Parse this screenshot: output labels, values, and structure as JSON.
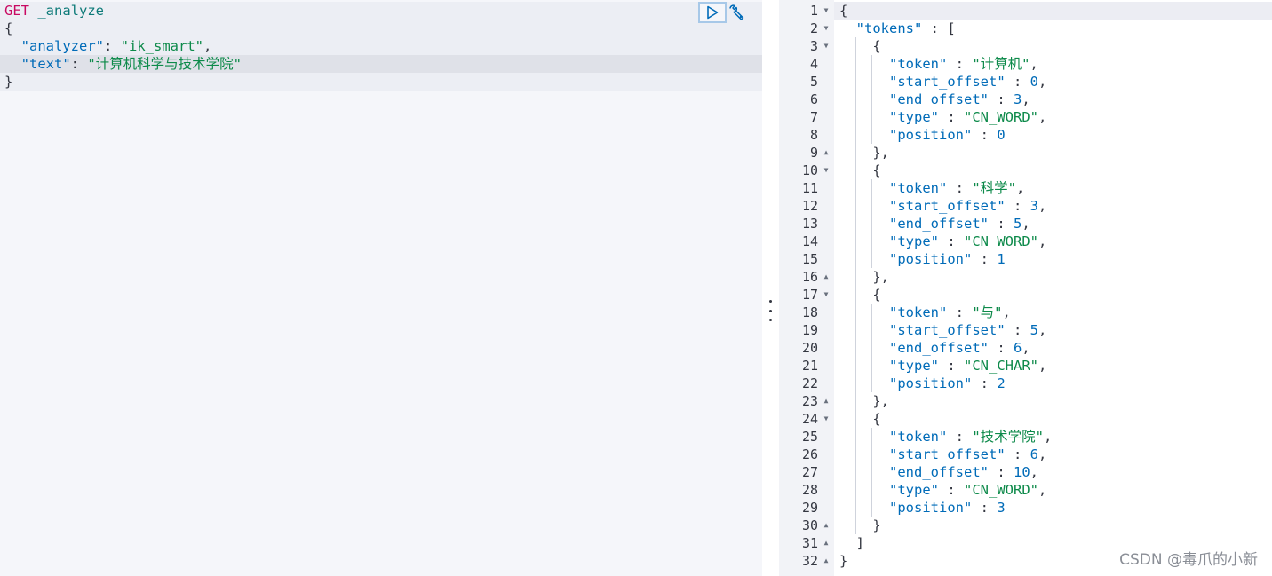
{
  "request": {
    "method": "GET",
    "endpoint": "_analyze",
    "open_brace": "{",
    "close_brace": "}",
    "analyzer_key": "\"analyzer\"",
    "analyzer_value": "\"ik_smart\"",
    "text_key": "\"text\"",
    "text_value": "\"计算机科学与技术学院\""
  },
  "toolbar": {
    "run_icon": "play-icon",
    "settings_icon": "wrench-icon"
  },
  "response": {
    "open_brace": "{",
    "tokens_key": "\"tokens\"",
    "tokens": [
      {
        "token": "\"计算机\"",
        "start_offset": "0",
        "end_offset": "3",
        "type": "\"CN_WORD\"",
        "position": "0"
      },
      {
        "token": "\"科学\"",
        "start_offset": "3",
        "end_offset": "5",
        "type": "\"CN_WORD\"",
        "position": "1"
      },
      {
        "token": "\"与\"",
        "start_offset": "5",
        "end_offset": "6",
        "type": "\"CN_CHAR\"",
        "position": "2"
      },
      {
        "token": "\"技术学院\"",
        "start_offset": "6",
        "end_offset": "10",
        "type": "\"CN_WORD\"",
        "position": "3"
      }
    ],
    "close_bracket": "]",
    "close_brace": "}",
    "line_numbers": [
      "1",
      "2",
      "3",
      "4",
      "5",
      "6",
      "7",
      "8",
      "9",
      "10",
      "11",
      "12",
      "13",
      "14",
      "15",
      "16",
      "17",
      "18",
      "19",
      "20",
      "21",
      "22",
      "23",
      "24",
      "25",
      "26",
      "27",
      "28",
      "29",
      "30",
      "31",
      "32"
    ]
  },
  "watermark": "CSDN @毒爪的小新",
  "colors": {
    "method": "#c90a62",
    "endpoint": "#0d7a78",
    "key": "#006bb8",
    "string": "#0d8a4a"
  }
}
